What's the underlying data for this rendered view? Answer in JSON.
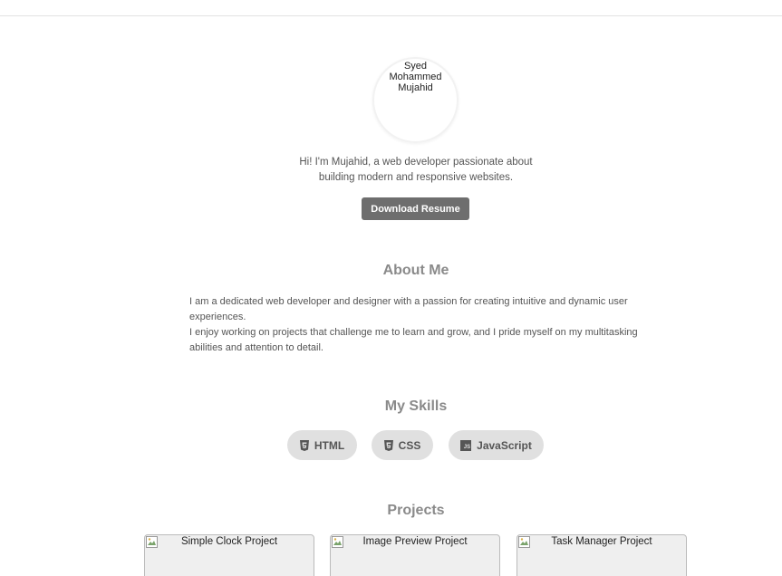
{
  "profile": {
    "image_alt": "Syed Mohammed Mujahid",
    "intro": "Hi! I'm Mujahid, a web developer passionate about building modern and responsive websites.",
    "resume_button": "Download Resume"
  },
  "about": {
    "title": "About Me",
    "paragraph_1": "I am a dedicated web developer and designer with a passion for creating intuitive and dynamic user experiences.",
    "paragraph_2": "I enjoy working on projects that challenge me to learn and grow, and I pride myself on my multitasking abilities and attention to detail."
  },
  "skills": {
    "title": "My Skills",
    "items": [
      {
        "label": "HTML",
        "icon": "html5-icon"
      },
      {
        "label": "CSS",
        "icon": "css3-icon"
      },
      {
        "label": "JavaScript",
        "icon": "javascript-icon"
      }
    ]
  },
  "projects": {
    "title": "Projects",
    "items": [
      {
        "image_alt": "Simple Clock Project"
      },
      {
        "image_alt": "Image Preview Project"
      },
      {
        "image_alt": "Task Manager Project"
      }
    ]
  },
  "colors": {
    "button_bg": "#6e6e6e",
    "skill_pill_bg": "#e0e0e0",
    "section_title": "#8a8a8a"
  }
}
